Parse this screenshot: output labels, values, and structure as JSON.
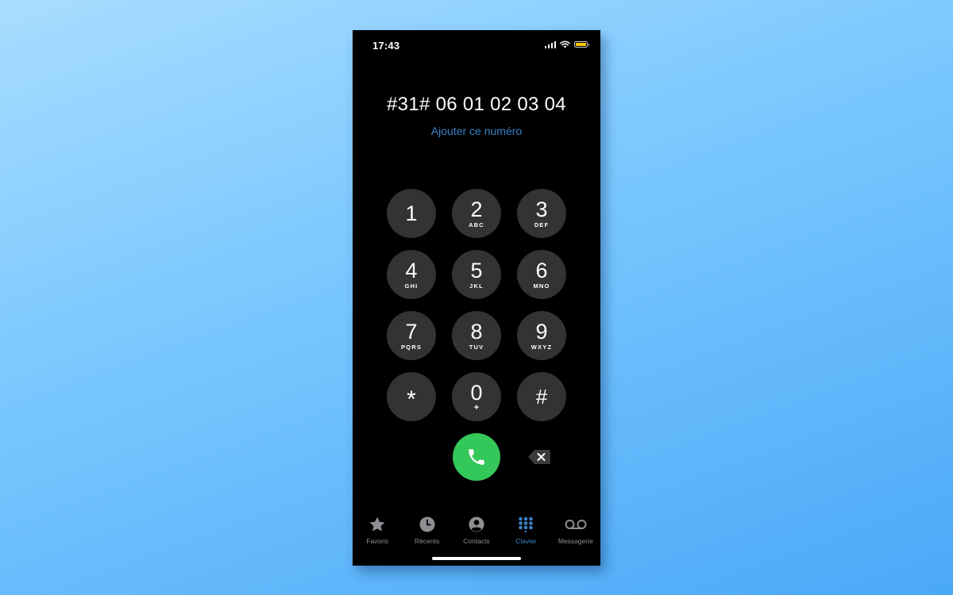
{
  "status_bar": {
    "time": "17:43",
    "battery_color": "#f5c400"
  },
  "dialer": {
    "number": "#31# 06 01 02 03 04",
    "add_number_link": "Ajouter ce numéro",
    "keys": [
      {
        "digit": "1",
        "letters": ""
      },
      {
        "digit": "2",
        "letters": "ABC"
      },
      {
        "digit": "3",
        "letters": "DEF"
      },
      {
        "digit": "4",
        "letters": "GHI"
      },
      {
        "digit": "5",
        "letters": "JKL"
      },
      {
        "digit": "6",
        "letters": "MNO"
      },
      {
        "digit": "7",
        "letters": "PQRS"
      },
      {
        "digit": "8",
        "letters": "TUV"
      },
      {
        "digit": "9",
        "letters": "WXYZ"
      },
      {
        "digit": "*",
        "letters": ""
      },
      {
        "digit": "0",
        "letters": "+"
      },
      {
        "digit": "#",
        "letters": ""
      }
    ],
    "call_icon": "phone-icon",
    "delete_icon": "backspace-icon"
  },
  "tab_bar": {
    "tabs": [
      {
        "label": "Favoris",
        "icon": "star-icon"
      },
      {
        "label": "Récents",
        "icon": "clock-icon"
      },
      {
        "label": "Contacts",
        "icon": "person-circle-icon"
      },
      {
        "label": "Clavier",
        "icon": "keypad-icon",
        "active": true
      },
      {
        "label": "Messagerie",
        "icon": "voicemail-icon"
      }
    ]
  },
  "colors": {
    "accent": "#3b82c6",
    "call_green": "#34c759",
    "key_background": "#333333",
    "tab_inactive": "#8e8e93"
  }
}
